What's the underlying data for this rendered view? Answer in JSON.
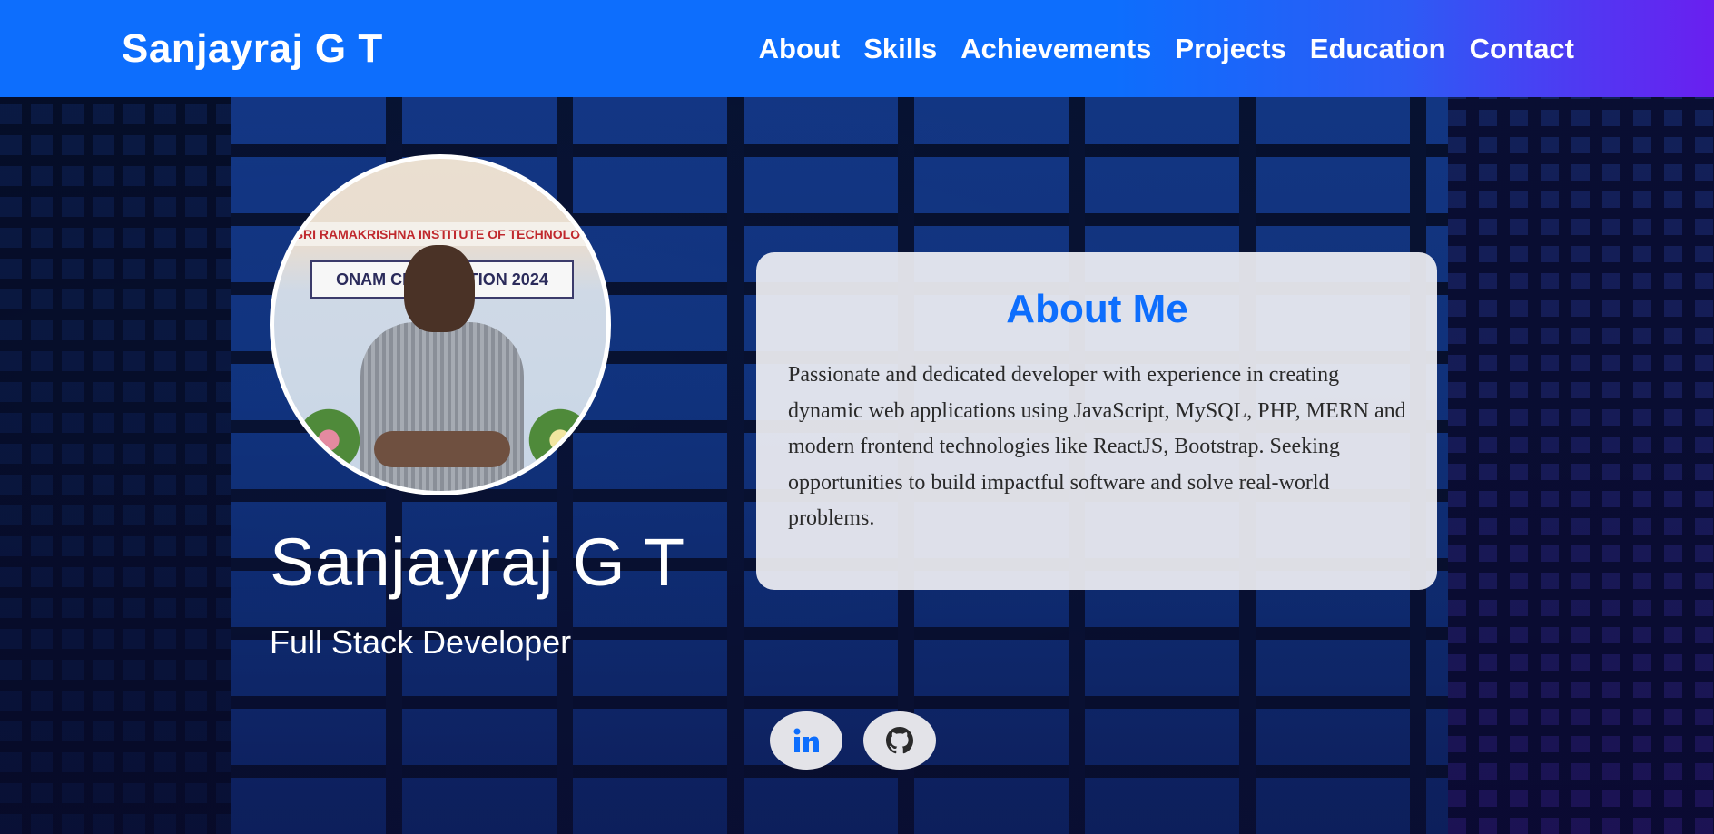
{
  "navbar": {
    "brand": "Sanjayraj G T",
    "links": [
      "About",
      "Skills",
      "Achievements",
      "Projects",
      "Education",
      "Contact"
    ]
  },
  "hero": {
    "photo": {
      "banner_text": "SRI RAMAKRISHNA INSTITUTE OF TECHNOLOGY",
      "sign_text": "ONAM CELEBRATION 2024"
    },
    "name": "Sanjayraj G T",
    "role": "Full Stack Developer"
  },
  "about": {
    "title": "About Me",
    "text": "Passionate and dedicated developer with experience in creating dynamic web applications using JavaScript, MySQL, PHP, MERN and modern frontend technologies like ReactJS, Bootstrap. Seeking opportunities to build impactful software and solve real-world problems."
  },
  "social": {
    "icons": [
      "linkedin-icon",
      "github-icon"
    ]
  },
  "colors": {
    "primary": "#0d6efd",
    "nav_gradient_end": "#6a1ff0",
    "card_bg": "#f0f0f4"
  }
}
